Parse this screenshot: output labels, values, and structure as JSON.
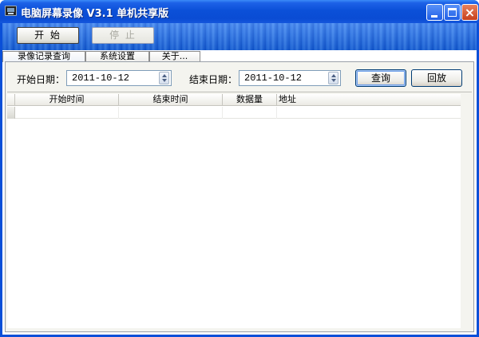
{
  "window": {
    "title": "电脑屏幕录像 V3.1 单机共享版",
    "icon": "monitor-icon",
    "controls": {
      "minimize_icon": "minimize-icon",
      "maximize_icon": "maximize-icon",
      "close_glyph": "×"
    },
    "colors": {
      "titlebar": "#0a4cd4",
      "toolbar": "#1b6ae6",
      "close": "#c7401c"
    }
  },
  "toolbar": {
    "start_label": "开 始",
    "stop_label": "停 止",
    "stop_disabled": true
  },
  "tabs": [
    {
      "label": "录像记录查询",
      "active": true
    },
    {
      "label": "系统设置",
      "active": false
    },
    {
      "label": "关于...",
      "active": false
    }
  ],
  "filter": {
    "start_label": "开始日期：",
    "start_value": "2011-10-12",
    "end_label": "结束日期：",
    "end_value": "2011-10-12",
    "query_label": "查询",
    "replay_label": "回放"
  },
  "grid": {
    "columns": [
      "开始时间",
      "结束时间",
      "数据量",
      "地址"
    ],
    "rows": [
      [
        "",
        "",
        "",
        ""
      ]
    ]
  }
}
